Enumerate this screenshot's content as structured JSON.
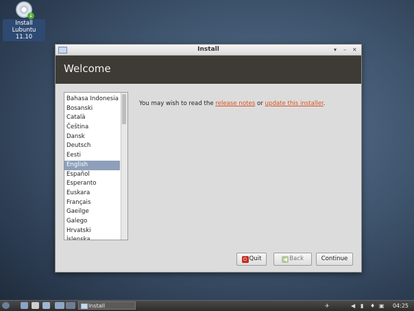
{
  "desktop": {
    "icon_label_line1": "Install",
    "icon_label_line2": "Lubuntu 11.10"
  },
  "window": {
    "title": "Install",
    "controls": {
      "menu": "▾",
      "minimize": "–",
      "close": "✕"
    },
    "banner_title": "Welcome",
    "languages": [
      "Bahasa Indonesia",
      "Bosanski",
      "Català",
      "Čeština",
      "Dansk",
      "Deutsch",
      "Eesti",
      "English",
      "Español",
      "Esperanto",
      "Euskara",
      "Français",
      "Gaeilge",
      "Galego",
      "Hrvatski",
      "Íslenska"
    ],
    "selected_language": "English",
    "intro": {
      "prefix": "You may wish to read the ",
      "link1": "release notes",
      "middle": " or ",
      "link2": "update this installer",
      "suffix": "."
    },
    "buttons": {
      "quit": "Quit",
      "back": "Back",
      "continue": "Continue"
    }
  },
  "taskbar": {
    "task_label": "Install",
    "clock": "04:25"
  },
  "colors": {
    "link": "#d9531e",
    "banner": "#3e3a35",
    "selection": "#8d9fb9"
  }
}
